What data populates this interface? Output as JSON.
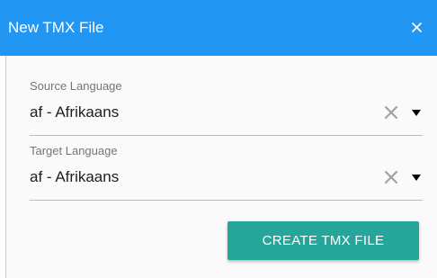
{
  "dialog": {
    "title": "New TMX File",
    "close_icon": "close-icon"
  },
  "source": {
    "label": "Source Language",
    "value": "af - Afrikaans"
  },
  "target": {
    "label": "Target Language",
    "value": "af - Afrikaans"
  },
  "actions": {
    "create_label": "CREATE TMX FILE"
  },
  "colors": {
    "header": "#2196f3",
    "button": "#26a69a"
  }
}
